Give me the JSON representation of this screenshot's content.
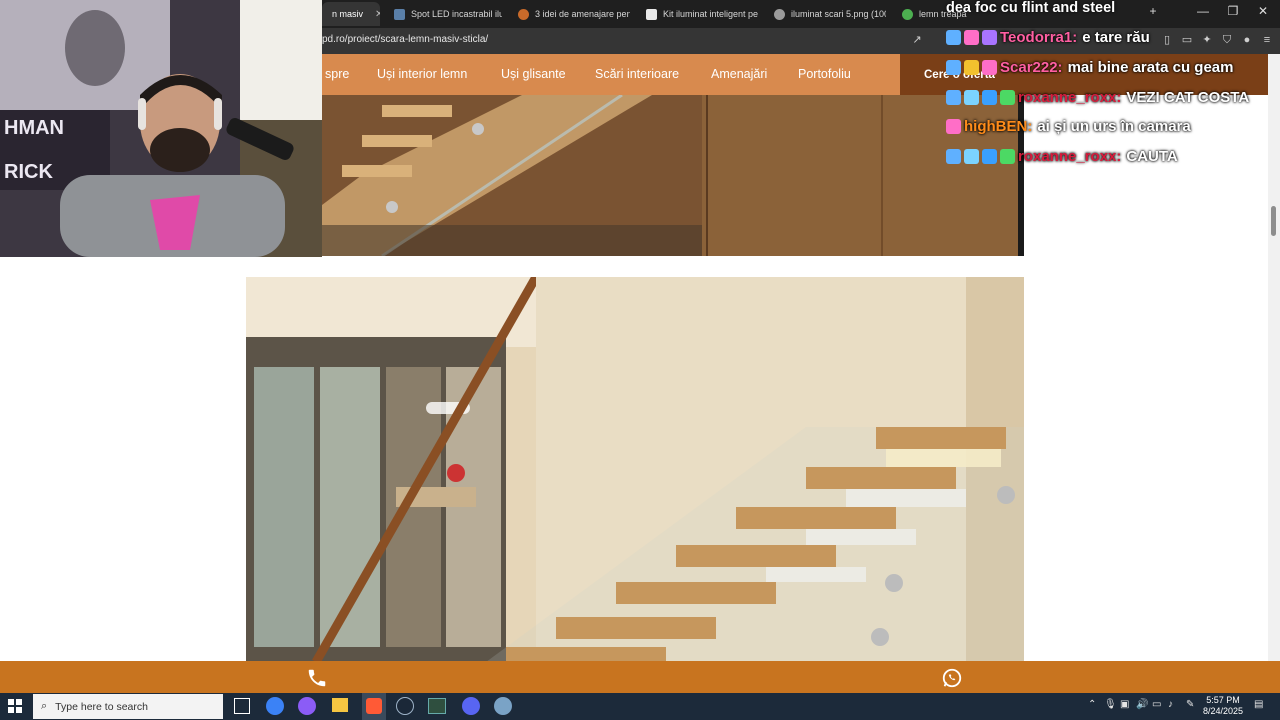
{
  "browser": {
    "tabs": [
      {
        "label": "n masiv",
        "active": true
      },
      {
        "label": "Spot LED incastrabil ilumi"
      },
      {
        "label": "3 idei de amenajare pentr"
      },
      {
        "label": "Kit iluminat inteligent pen"
      },
      {
        "label": "iluminat scari 5.png (1000"
      },
      {
        "label": "lemn treapa"
      }
    ],
    "tab_overlay_text": "dea foc cu flint and steel",
    "url": "pd.ro/proiect/scara-lemn-masiv-sticla/"
  },
  "site_nav": {
    "items": [
      "spre",
      "Uși interior lemn",
      "Uși glisante",
      "Scări interioare",
      "Amenajări",
      "Portofoliu"
    ],
    "cta": "Cere o ofertă"
  },
  "chat": [
    {
      "user": "Teodorra1:",
      "message": "e tare rău",
      "user_color": "#ff5fa2"
    },
    {
      "user": "Scar222:",
      "message": "mai bine arata cu geam",
      "user_color": "#ff5fa2"
    },
    {
      "user": "roxanne_roxx:",
      "message": "VEZI CAT COSTA",
      "user_color": "#d81b3c"
    },
    {
      "user": "highBEN:",
      "message": "ai și un urs în camara",
      "user_color": "#ff8c1a"
    },
    {
      "user": "roxanne_roxx:",
      "message": "CAUTA",
      "user_color": "#d81b3c"
    }
  ],
  "webcam": {
    "hoodie_text": "HMAN\nRICK"
  },
  "taskbar": {
    "search_placeholder": "Type here to search",
    "time": "5:57 PM",
    "date": "8/24/2025"
  },
  "colors": {
    "nav_bg": "#d88a4e",
    "cta_bg": "#7a3f17",
    "bottom_bar": "#c8741f",
    "taskbar_bg": "#1c2a3a"
  }
}
